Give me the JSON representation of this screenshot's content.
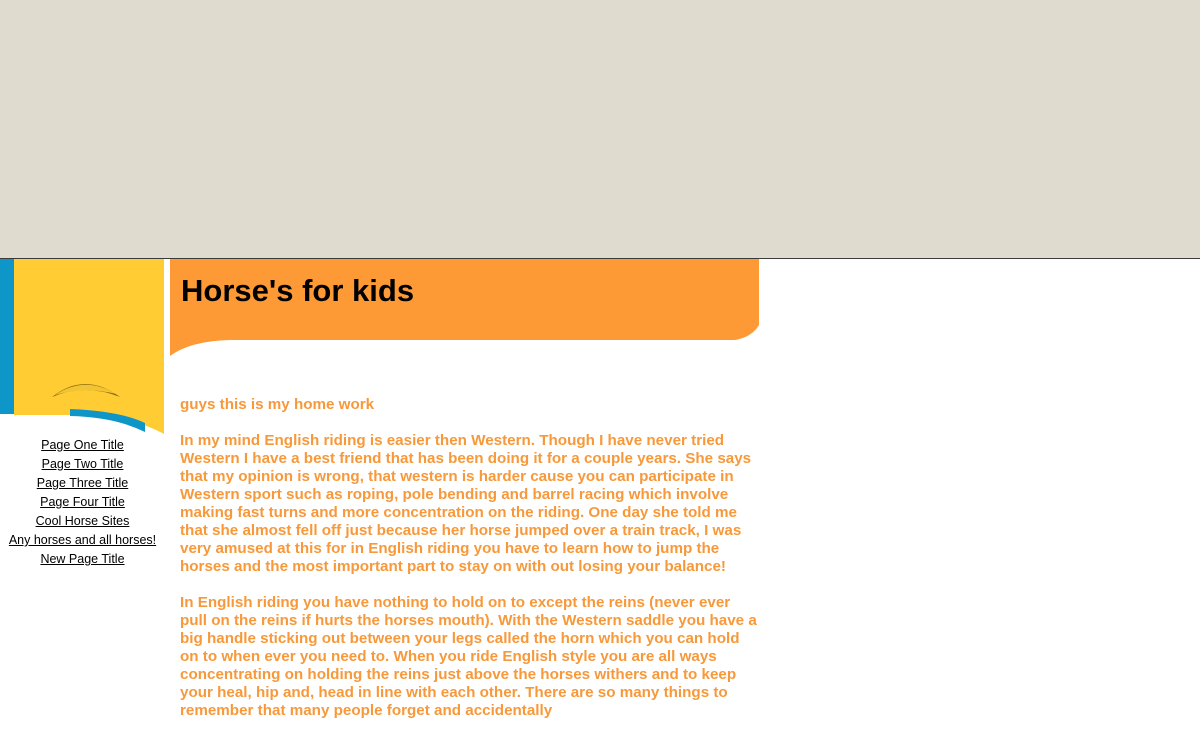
{
  "site": {
    "title": "Horse's for kids"
  },
  "nav": {
    "items": [
      {
        "label": "Page One Title"
      },
      {
        "label": "Page Two Title"
      },
      {
        "label": "Page Three Title"
      },
      {
        "label": "Page Four Title"
      },
      {
        "label": "Cool Horse Sites"
      },
      {
        "label": "Any horses and all horses!"
      },
      {
        "label": "New Page Title"
      }
    ]
  },
  "content": {
    "intro": "guys this is my home work",
    "paragraphs": [
      "In my mind English riding is easier then Western. Though I have never tried Western I have a best friend that has been doing it for a couple years. She says that my opinion is wrong, that western is harder cause you can participate in Western sport such as roping, pole bending and barrel racing which involve making fast turns and more concentration on the riding. One day she told me that she almost fell off just because her horse jumped over a train track, I was very amused at this for in English riding you have to learn how to jump the horses and the most important part to stay on with out losing your balance!",
      "In English riding you have nothing to hold on to except the reins (never ever pull on the reins if hurts the horses mouth). With the Western saddle you have a big handle sticking out between your legs called the horn which you can hold on to when ever you need to. When you ride English style you are all ways concentrating on holding the reins just above the horses withers and to keep your heal, hip and, head in line with each other. There are so many things to remember that many people forget and accidentally"
    ]
  },
  "colors": {
    "banner": "#dfdbcf",
    "accent_orange": "#fd9a36",
    "accent_yellow": "#ffcc33",
    "accent_blue": "#0e96c8",
    "text_orange": "#f7993a"
  },
  "icons": {
    "sidebar_decoration": "yellow-swoosh-icon"
  }
}
